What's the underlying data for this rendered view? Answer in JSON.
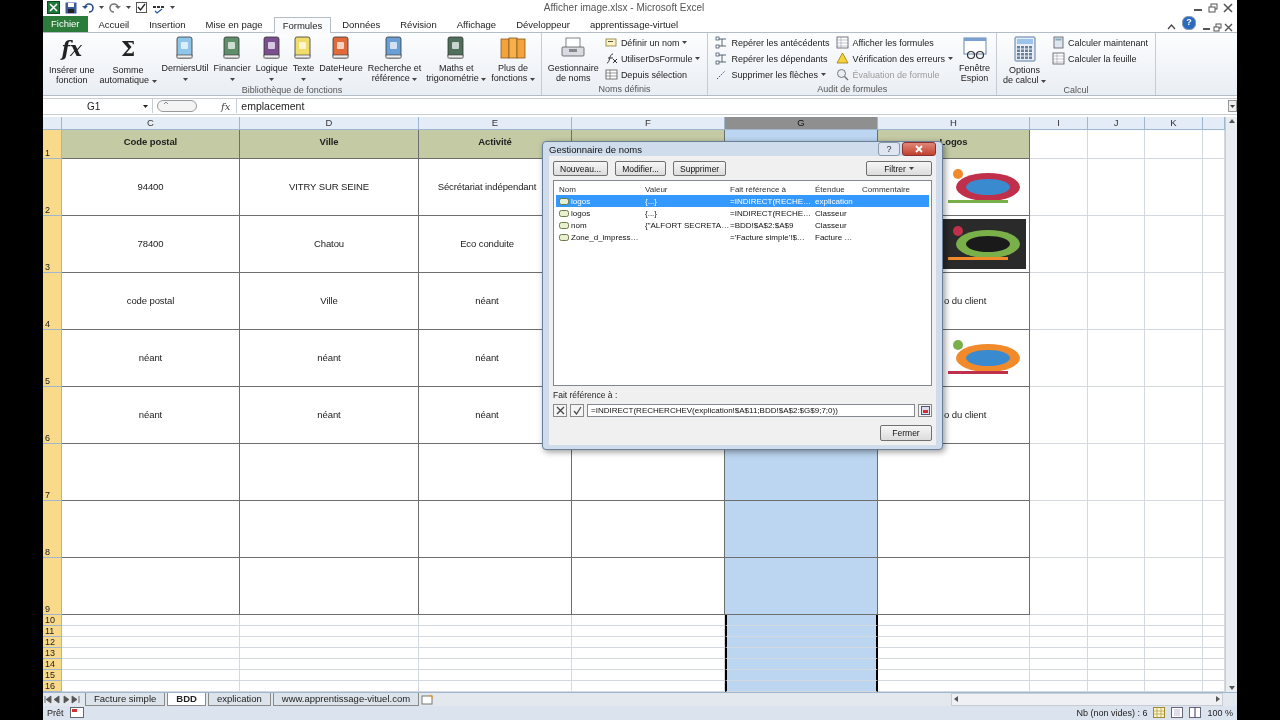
{
  "title_bar": {
    "title": "Afficher image.xlsx  -  Microsoft Excel"
  },
  "ribbon": {
    "tabs": [
      {
        "label": "Fichier",
        "selected": false,
        "kind": "file"
      },
      {
        "label": "Accueil",
        "selected": false,
        "kind": "tab"
      },
      {
        "label": "Insertion",
        "selected": false,
        "kind": "tab"
      },
      {
        "label": "Mise en page",
        "selected": false,
        "kind": "tab"
      },
      {
        "label": "Formules",
        "selected": true,
        "kind": "tab"
      },
      {
        "label": "Données",
        "selected": false,
        "kind": "tab"
      },
      {
        "label": "Révision",
        "selected": false,
        "kind": "tab"
      },
      {
        "label": "Affichage",
        "selected": false,
        "kind": "tab"
      },
      {
        "label": "Développeur",
        "selected": false,
        "kind": "tab"
      },
      {
        "label": "apprentissage-virtuel",
        "selected": false,
        "kind": "tab"
      }
    ],
    "help": "?",
    "groups": [
      {
        "label": "Bibliothèque de fonctions",
        "columns": [
          {
            "kind": "large",
            "label": "Insérer une\nfonction",
            "dropdown": false,
            "glyph": "fx"
          },
          {
            "kind": "large",
            "label": "Somme\nautomatique",
            "dropdown": true,
            "glyph": "Σ"
          },
          {
            "kind": "large",
            "label": "DerniersUtil",
            "dropdown": true
          },
          {
            "kind": "large",
            "label": "Financier",
            "dropdown": true
          },
          {
            "kind": "large",
            "label": "Logique",
            "dropdown": true
          },
          {
            "kind": "large",
            "label": "Texte",
            "dropdown": true
          },
          {
            "kind": "large",
            "label": "DateHeure",
            "dropdown": true
          },
          {
            "kind": "large",
            "label": "Recherche et\nréférence",
            "dropdown": true
          },
          {
            "kind": "large",
            "label": "Maths et\ntrigonométrie",
            "dropdown": true
          },
          {
            "kind": "large",
            "label": "Plus de\nfonctions",
            "dropdown": true
          }
        ]
      },
      {
        "label": "Noms définis",
        "columns": [
          {
            "kind": "large",
            "label": "Gestionnaire\nde noms",
            "dropdown": false
          },
          {
            "kind": "stack",
            "items": [
              {
                "label": "Définir un nom",
                "dropdown": true,
                "disabled": false
              },
              {
                "label": "UtiliserDsFormule",
                "dropdown": true,
                "disabled": false
              },
              {
                "label": "Depuis sélection",
                "dropdown": false,
                "disabled": false
              }
            ]
          }
        ]
      },
      {
        "label": "Audit de formules",
        "columns": [
          {
            "kind": "stack",
            "items": [
              {
                "label": "Repérer les antécédents",
                "dropdown": false,
                "disabled": false
              },
              {
                "label": "Repérer les dépendants",
                "dropdown": false,
                "disabled": false
              },
              {
                "label": "Supprimer les flèches",
                "dropdown": true,
                "disabled": false
              }
            ]
          },
          {
            "kind": "stack",
            "items": [
              {
                "label": "Afficher les formules",
                "dropdown": false,
                "disabled": false
              },
              {
                "label": "Vérification des erreurs",
                "dropdown": true,
                "disabled": false
              },
              {
                "label": "Évaluation de formule",
                "dropdown": false,
                "disabled": true
              }
            ]
          },
          {
            "kind": "large",
            "label": "Fenêtre\nEspion",
            "dropdown": false
          }
        ]
      },
      {
        "label": "Calcul",
        "columns": [
          {
            "kind": "large",
            "label": "Options\nde calcul",
            "dropdown": true
          },
          {
            "kind": "stack",
            "items": [
              {
                "label": "Calculer maintenant",
                "dropdown": false,
                "disabled": false
              },
              {
                "label": "Calculer la feuille",
                "dropdown": false,
                "disabled": false
              }
            ]
          }
        ]
      }
    ]
  },
  "formula_bar": {
    "name_box": "G1",
    "fx": "fx",
    "formula": "emplacement"
  },
  "sheet": {
    "columns": [
      {
        "letter": "C",
        "selected": false
      },
      {
        "letter": "D",
        "selected": false
      },
      {
        "letter": "E",
        "selected": false
      },
      {
        "letter": "F",
        "selected": false
      },
      {
        "letter": "G",
        "selected": true
      },
      {
        "letter": "H",
        "selected": false
      },
      {
        "letter": "I",
        "selected": false
      },
      {
        "letter": "J",
        "selected": false
      },
      {
        "letter": "K",
        "selected": false
      }
    ],
    "rows": [
      {
        "number": "1",
        "kind": "header",
        "cells": [
          "Code postal",
          "Ville",
          "Activité",
          null,
          null,
          "Logos"
        ]
      },
      {
        "number": "2",
        "kind": "record",
        "cells": [
          "94400",
          "VITRY SUR SEINE",
          "Sécrétariat indépendant",
          null,
          null,
          {
            "kind": "picture"
          }
        ]
      },
      {
        "number": "3",
        "kind": "record",
        "cells": [
          "78400",
          "Chatou",
          "Eco conduite",
          null,
          null,
          {
            "kind": "picture"
          }
        ]
      },
      {
        "number": "4",
        "kind": "record",
        "cells": [
          "code postal",
          "Ville",
          "néant",
          null,
          null,
          "o du client"
        ]
      },
      {
        "number": "5",
        "kind": "record",
        "cells": [
          "néant",
          "néant",
          "néant",
          null,
          null,
          {
            "kind": "picture"
          }
        ]
      },
      {
        "number": "6",
        "kind": "record",
        "cells": [
          "néant",
          "néant",
          "néant",
          null,
          null,
          "o du client"
        ]
      },
      {
        "number": "7",
        "kind": "record"
      },
      {
        "number": "8",
        "kind": "record"
      },
      {
        "number": "9",
        "kind": "record"
      },
      {
        "number": "10",
        "kind": "blank"
      },
      {
        "number": "11",
        "kind": "blank"
      },
      {
        "number": "12",
        "kind": "blank"
      },
      {
        "number": "13",
        "kind": "blank"
      },
      {
        "number": "14",
        "kind": "blank"
      },
      {
        "number": "15",
        "kind": "blank"
      },
      {
        "number": "16",
        "kind": "blank"
      }
    ]
  },
  "dialog": {
    "title": "Gestionnaire de noms",
    "help": "?",
    "buttons": [
      "Nouveau...",
      "Modifier...",
      "Supprimer"
    ],
    "filter": "Filtrer",
    "columns": [
      "Nom",
      "Valeur",
      "Fait référence à",
      "Étendue",
      "Commentaire"
    ],
    "rows": [
      {
        "name": "logos",
        "value": "{...}",
        "refers_to": "=INDIRECT(RECHE…",
        "scope": "explication",
        "selected": true
      },
      {
        "name": "logos",
        "value": "{...}",
        "refers_to": "=INDIRECT(RECHE…",
        "scope": "Classeur",
        "selected": false
      },
      {
        "name": "nom",
        "value": "{\"ALFORT SECRETA…",
        "refers_to": "=BDD!$A$2:$A$9",
        "scope": "Classeur",
        "selected": false
      },
      {
        "name": "Zone_d_impress…",
        "refers_to": "='Facture simple'!$…",
        "scope": "Facture …",
        "selected": false
      }
    ],
    "ref_label": "Fait référence à :",
    "ref_value": "=INDIRECT(RECHERCHEV(explication!$A$11;BDD!$A$2:$G$9;7;0))",
    "close": "Fermer"
  },
  "sheet_tabs": [
    {
      "label": "Facture simple",
      "selected": false
    },
    {
      "label": "BDD",
      "selected": true
    },
    {
      "label": "explication",
      "selected": false
    },
    {
      "label": "www.apprentissage-vituel.com",
      "selected": false
    }
  ],
  "status_bar": {
    "mode": "Prêt",
    "count": "Nb (non vides) : 6",
    "zoom": "100 %"
  }
}
